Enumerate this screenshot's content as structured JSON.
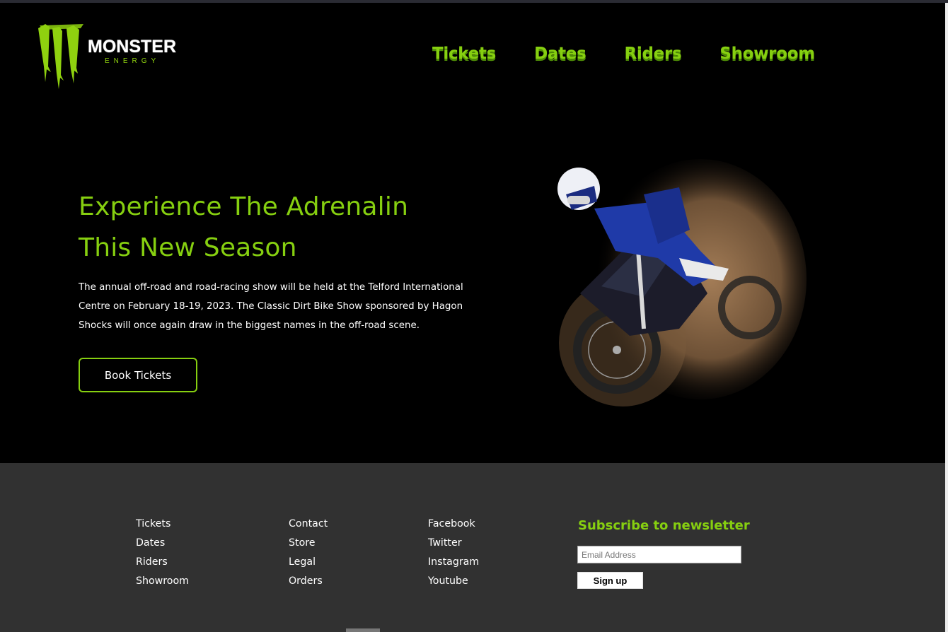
{
  "logo": {
    "brand": "MONSTER",
    "sub": "ENERGY"
  },
  "nav": [
    "Tickets",
    "Dates",
    "Riders",
    "Showroom"
  ],
  "hero": {
    "title_line1": "Experience The Adrenalin",
    "title_line2": "This New Season",
    "description": "The annual off-road and road-racing show will be held at the Telford International Centre on February 18-19, 2023. The Classic Dirt Bike Show sponsored by Hagon Shocks will once again draw in the biggest names in the off-road scene.",
    "cta": "Book Tickets"
  },
  "footer": {
    "col1": [
      "Tickets",
      "Dates",
      "Riders",
      "Showroom"
    ],
    "col2": [
      "Contact",
      "Store",
      "Legal",
      "Orders"
    ],
    "col3": [
      "Facebook",
      "Twitter",
      "Instagram",
      "Youtube"
    ],
    "newsletter": {
      "title": "Subscribe to newsletter",
      "placeholder": "Email Address",
      "button": "Sign up"
    }
  },
  "colors": {
    "accent": "#86cf10",
    "background": "#000000",
    "footer": "#313131"
  }
}
